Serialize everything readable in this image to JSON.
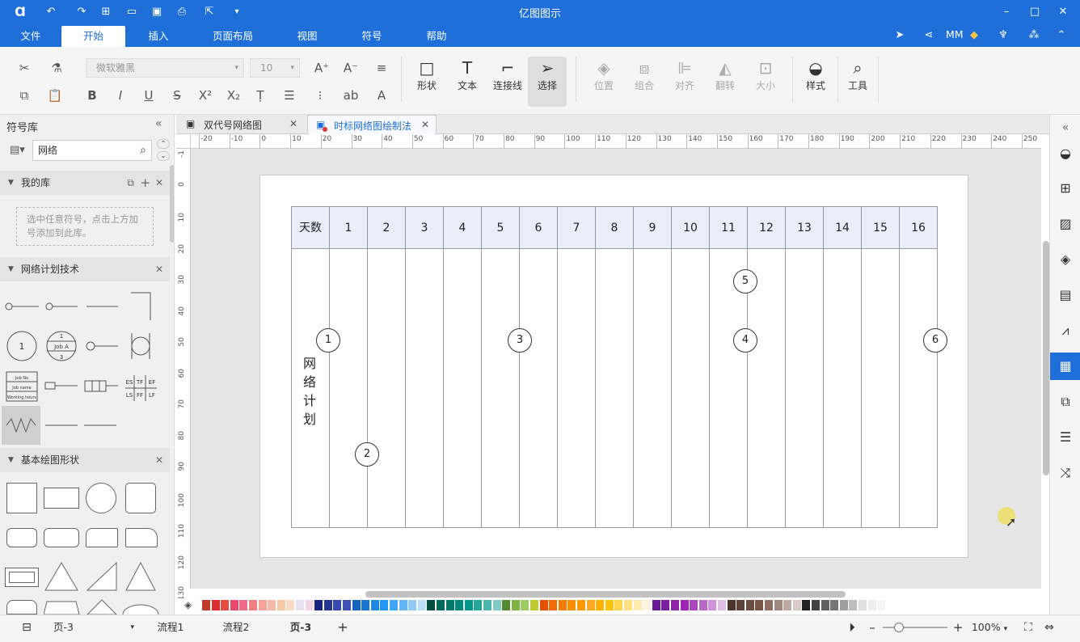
{
  "window": {
    "title": "亿图图示"
  },
  "menu": [
    "文件",
    "开始",
    "插入",
    "页面布局",
    "视图",
    "符号",
    "帮助"
  ],
  "user": "MM",
  "ribbon": {
    "font_name": "微软雅黑",
    "font_size": "10",
    "tools": [
      {
        "label": "形状",
        "icon": "rectangle-icon",
        "enabled": true
      },
      {
        "label": "文本",
        "icon": "text-icon",
        "enabled": true
      },
      {
        "label": "连接线",
        "icon": "connector-icon",
        "enabled": true
      },
      {
        "label": "选择",
        "icon": "pointer-icon",
        "enabled": true
      },
      {
        "label": "位置",
        "icon": "layers-icon",
        "enabled": false
      },
      {
        "label": "组合",
        "icon": "group-icon",
        "enabled": false
      },
      {
        "label": "对齐",
        "icon": "align-icon",
        "enabled": false
      },
      {
        "label": "翻转",
        "icon": "flip-icon",
        "enabled": false
      },
      {
        "label": "大小",
        "icon": "size-icon",
        "enabled": false
      },
      {
        "label": "样式",
        "icon": "paint-bucket-icon",
        "enabled": true
      },
      {
        "label": "工具",
        "icon": "tools-icon",
        "enabled": true
      }
    ]
  },
  "library": {
    "title": "符号库",
    "search_value": "网络",
    "my_library": {
      "title": "我的库",
      "hint": "选中任意符号，点击上方加号添加到此库。"
    },
    "network": {
      "title": "网络计划技术",
      "job_label": "Job A",
      "job_top": "1",
      "job_bottom": "3",
      "node_label": "1",
      "table_rows": [
        "Job No",
        "Job name",
        "Working hours"
      ],
      "es_labels": [
        "ES",
        "TF",
        "EF",
        "LS",
        "FF",
        "LF"
      ]
    },
    "basic": {
      "title": "基本绘图形状"
    }
  },
  "tabs": [
    {
      "label": "双代号网络图",
      "active": false
    },
    {
      "label": "时标网络图绘制法",
      "active": true
    }
  ],
  "ruler": {
    "h": [
      "-20",
      "-10",
      "0",
      "10",
      "20",
      "30",
      "40",
      "50",
      "60",
      "70",
      "80",
      "90",
      "100",
      "110",
      "120",
      "130",
      "140",
      "150",
      "160",
      "170",
      "180",
      "190",
      "200",
      "210",
      "220",
      "230",
      "240",
      "250"
    ],
    "v": [
      "-1",
      "0",
      "10",
      "20",
      "30",
      "40",
      "50",
      "60",
      "70",
      "80",
      "90",
      "100",
      "110",
      "120",
      "130"
    ]
  },
  "diagram": {
    "header_first": "天数",
    "days": [
      "1",
      "2",
      "3",
      "4",
      "5",
      "6",
      "7",
      "8",
      "9",
      "10",
      "11",
      "12",
      "13",
      "14",
      "15",
      "16"
    ],
    "vertical_label": [
      "网",
      "络",
      "计",
      "划"
    ],
    "nodes": [
      "1",
      "2",
      "3",
      "4",
      "5",
      "6"
    ]
  },
  "pages": [
    "页-3",
    "流程1",
    "流程2",
    "页-3"
  ],
  "zoom": "100%"
}
